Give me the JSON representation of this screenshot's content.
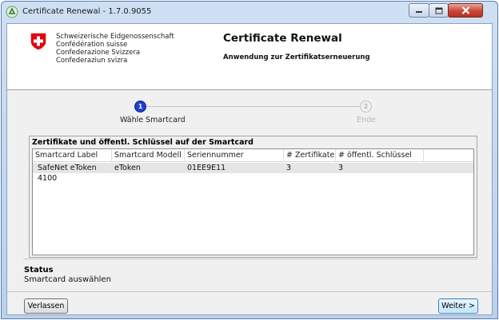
{
  "window": {
    "title": "Certificate Renewal - 1.7.0.9055",
    "controls": [
      "minimize-icon",
      "maximize-icon",
      "close-icon"
    ]
  },
  "header": {
    "confederation": [
      "Schweizerische Eidgenossenschaft",
      "Confédération suisse",
      "Confederazione Svizzera",
      "Confederaziun svizra"
    ],
    "app_title": "Certificate Renewal",
    "app_subtitle": "Anwendung zur Zertifikatserneuerung"
  },
  "stepper": {
    "steps": [
      {
        "number": "1",
        "label": "Wähle Smartcard",
        "active": true
      },
      {
        "number": "2",
        "label": "Ende",
        "active": false
      }
    ]
  },
  "group": {
    "title": "Zertifikate und öffentl. Schlüssel auf der Smartcard",
    "columns": [
      "Smartcard Label",
      "Smartcard Modell",
      "Seriennummer Smartcard",
      "# Zertifikate",
      "# öffentl. Schlüssel"
    ],
    "rows": [
      [
        "SafeNet eToken 4100",
        "eToken",
        "01EE9E11",
        "3",
        "3"
      ]
    ]
  },
  "status": {
    "title": "Status",
    "text": "Smartcard auswählen"
  },
  "footer": {
    "leave_label": "Verlassen",
    "next_label": "Weiter >"
  },
  "colors": {
    "active_step": "#1f3fd2",
    "inactive_step": "#b8b8b8",
    "swiss_red": "#e3000f"
  }
}
